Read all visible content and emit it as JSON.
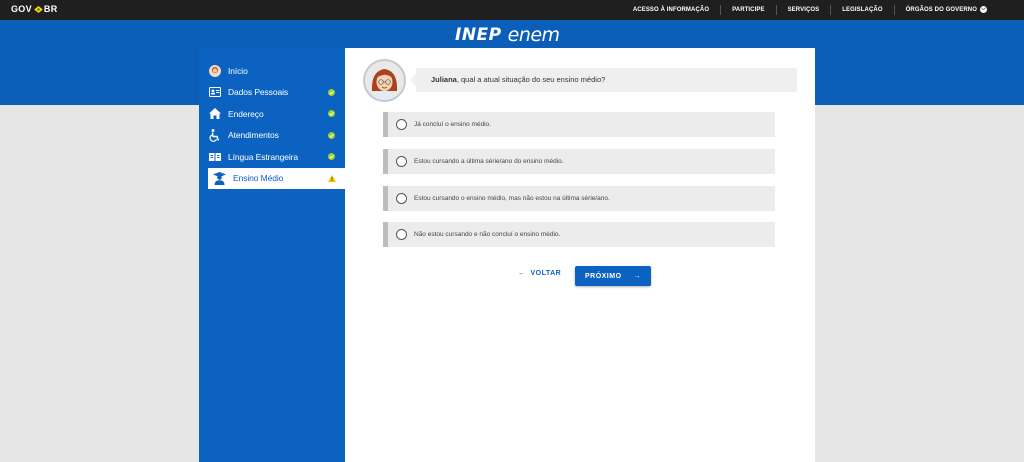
{
  "govbar": {
    "logo_left": "GOV",
    "logo_right": "BR",
    "links": [
      {
        "label": "ACESSO À INFORMAÇÃO"
      },
      {
        "label": "PARTICIPE"
      },
      {
        "label": "SERVIÇOS"
      },
      {
        "label": "LEGISLAÇÃO"
      },
      {
        "label": "ÓRGÃOS DO GOVERNO"
      }
    ]
  },
  "brand": {
    "inep": "INEP",
    "enem": "enem"
  },
  "sidebar": {
    "items": [
      {
        "label": "Início",
        "icon": "avatar-icon",
        "status": "none"
      },
      {
        "label": "Dados Pessoais",
        "icon": "id-card-icon",
        "status": "complete"
      },
      {
        "label": "Endereço",
        "icon": "home-icon",
        "status": "complete"
      },
      {
        "label": "Atendimentos",
        "icon": "wheelchair-icon",
        "status": "complete"
      },
      {
        "label": "Língua Estrangeira",
        "icon": "language-icon",
        "status": "complete"
      },
      {
        "label": "Ensino Médio",
        "icon": "student-icon",
        "status": "warning"
      }
    ]
  },
  "question": {
    "name": "Juliana",
    "text": ", qual a atual situação do seu ensino médio?"
  },
  "options": [
    {
      "label": "Já concluí o ensino médio."
    },
    {
      "label": "Estou cursando a última série/ano do ensino médio."
    },
    {
      "label": "Estou cursando o ensino médio, mas não estou na última série/ano."
    },
    {
      "label": "Não estou cursando e não concluí o ensino médio."
    }
  ],
  "buttons": {
    "back": "VOLTAR",
    "next": "PRÓXIMO"
  },
  "colors": {
    "primary": "#0b62c1",
    "complete": "#9ad12a",
    "warning": "#f5c400"
  }
}
